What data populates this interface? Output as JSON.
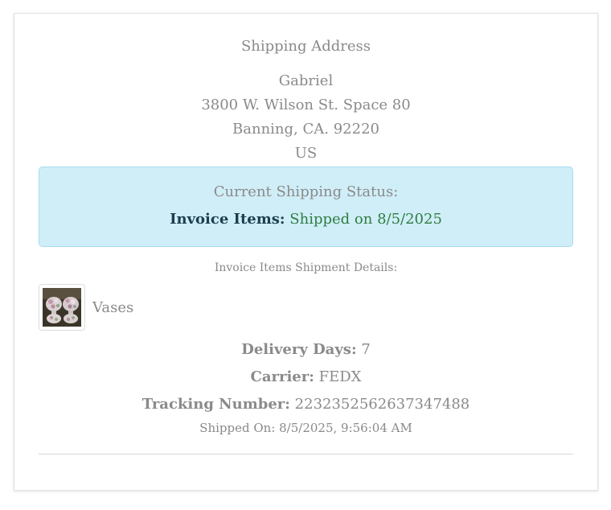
{
  "shipping_address": {
    "heading": "Shipping Address",
    "name": "Gabriel",
    "street": "3800 W. Wilson St. Space 80",
    "city_state_zip": "Banning, CA. 92220",
    "country": "US"
  },
  "status": {
    "title": "Current Shipping Status:",
    "label": "Invoice Items:",
    "value": "Shipped on 8/5/2025",
    "box_color": "#d0eef8",
    "value_color": "#2e7d40"
  },
  "shipment_details": {
    "heading": "Invoice Items Shipment Details:",
    "item": {
      "name": "Vases",
      "thumbnail_icon": "vases-photo"
    },
    "delivery_days_label": "Delivery Days:",
    "delivery_days_value": "7",
    "carrier_label": "Carrier:",
    "carrier_value": "FEDX",
    "tracking_label": "Tracking Number:",
    "tracking_value": "2232352562637347488",
    "shipped_on": "Shipped On: 8/5/2025, 9:56:04 AM"
  }
}
